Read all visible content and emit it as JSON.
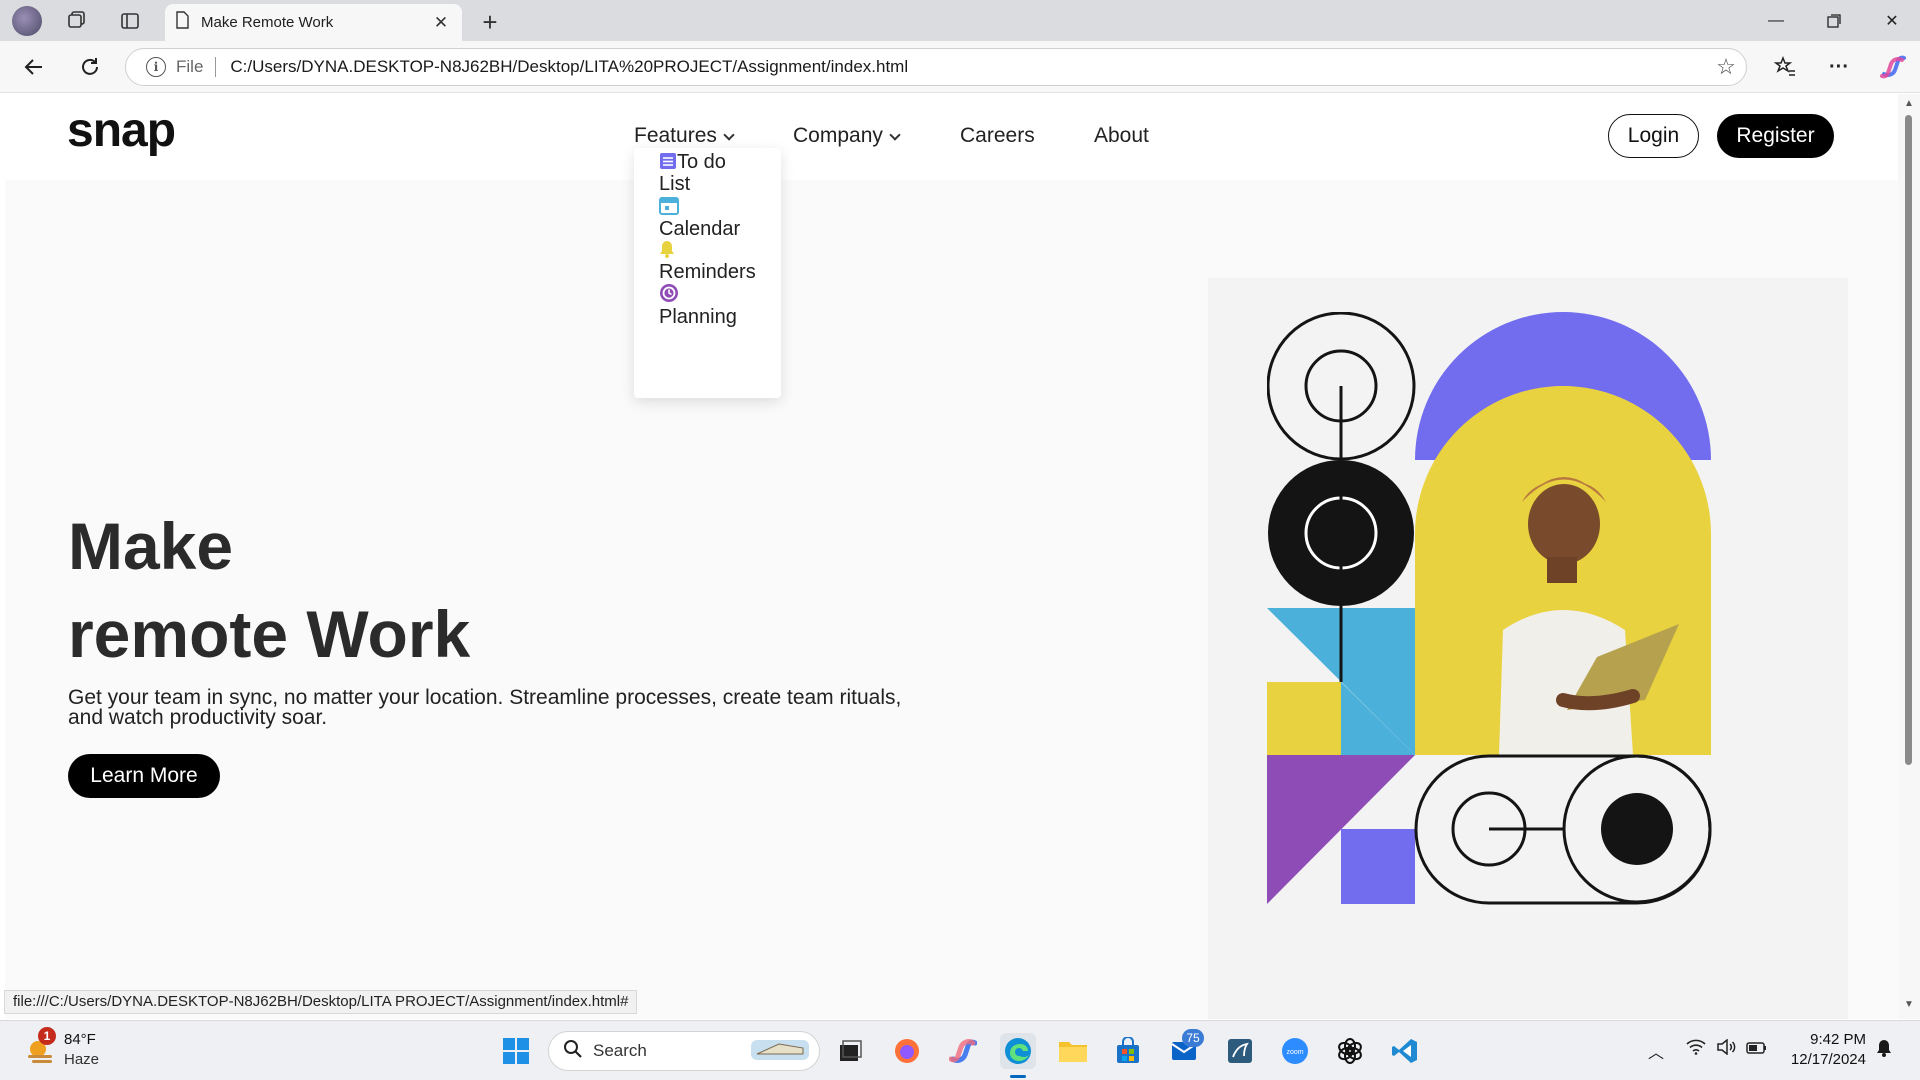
{
  "browser": {
    "tab_title": "Make Remote Work",
    "address_scheme": "File",
    "address_url": "C:/Users/DYNA.DESKTOP-N8J62BH/Desktop/LITA%20PROJECT/Assignment/index.html",
    "status_url": "file:///C:/Users/DYNA.DESKTOP-N8J62BH/Desktop/LITA PROJECT/Assignment/index.html#"
  },
  "site": {
    "logo": "snap",
    "nav": {
      "features": "Features",
      "company": "Company",
      "careers": "Careers",
      "about": "About"
    },
    "features_menu": [
      {
        "label": "To do List",
        "icon": "todo-icon",
        "color": "#726cee"
      },
      {
        "label": "Calendar",
        "icon": "calendar-icon",
        "color": "#4bb1da"
      },
      {
        "label": "Reminders",
        "icon": "bell-icon",
        "color": "#e9d23f"
      },
      {
        "label": "Planning",
        "icon": "planning-icon",
        "color": "#8e4cb6"
      }
    ],
    "login": "Login",
    "register": "Register"
  },
  "hero": {
    "title_line1": "Make",
    "title_line2": "remote Work",
    "description": "Get your team in sync, no matter your location. Streamline processes, create team rituals, and watch productivity soar.",
    "cta": "Learn More"
  },
  "colors": {
    "purple": "#726cee",
    "yellow": "#e9d23f",
    "blue": "#4bb1da",
    "violet": "#8e4cb6",
    "black": "#141414"
  },
  "taskbar": {
    "weather_temp": "84°F",
    "weather_desc": "Haze",
    "weather_badge": "1",
    "search_label": "Search",
    "mail_badge": "75",
    "time": "9:42 PM",
    "date": "12/17/2024"
  }
}
